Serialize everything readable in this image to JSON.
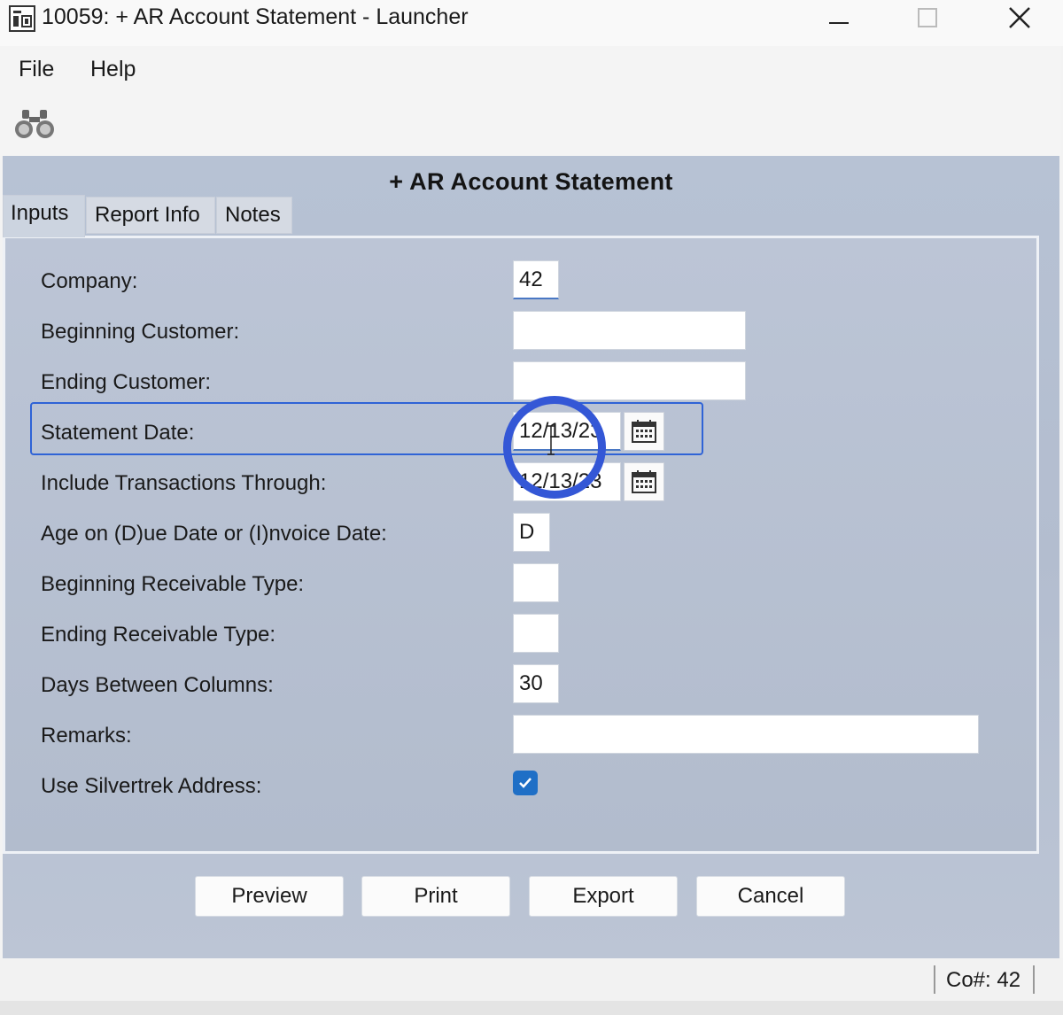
{
  "window": {
    "title": "10059: + AR Account Statement - Launcher"
  },
  "menu": {
    "file": "File",
    "help": "Help"
  },
  "toolbar": {
    "search_icon": "binoculars-icon"
  },
  "report": {
    "title": "+ AR Account Statement"
  },
  "tabs": [
    {
      "label": "Inputs",
      "active": true
    },
    {
      "label": "Report Info",
      "active": false
    },
    {
      "label": "Notes",
      "active": false
    }
  ],
  "fields": {
    "company": {
      "label": "Company:",
      "value": "42"
    },
    "beginning_customer": {
      "label": "Beginning Customer:",
      "value": ""
    },
    "ending_customer": {
      "label": "Ending Customer:",
      "value": ""
    },
    "statement_date": {
      "label": "Statement Date:",
      "value": "12/13/23"
    },
    "include_through": {
      "label": "Include Transactions Through:",
      "value": "12/13/23"
    },
    "age_on": {
      "label": "Age on (D)ue Date or (I)nvoice Date:",
      "value": "D"
    },
    "beginning_receivable_type": {
      "label": "Beginning Receivable Type:",
      "value": ""
    },
    "ending_receivable_type": {
      "label": "Ending Receivable Type:",
      "value": ""
    },
    "days_between_columns": {
      "label": "Days Between Columns:",
      "value": "30"
    },
    "remarks": {
      "label": "Remarks:",
      "value": ""
    },
    "use_silvertrek_address": {
      "label": "Use Silvertrek Address:",
      "checked": true
    }
  },
  "buttons": {
    "preview": "Preview",
    "print": "Print",
    "export": "Export",
    "cancel": "Cancel"
  },
  "status": {
    "company": "Co#: 42"
  },
  "colors": {
    "panel": "#b7c2d4",
    "highlight": "#2f63d6",
    "checkbox": "#1f6fc6"
  }
}
